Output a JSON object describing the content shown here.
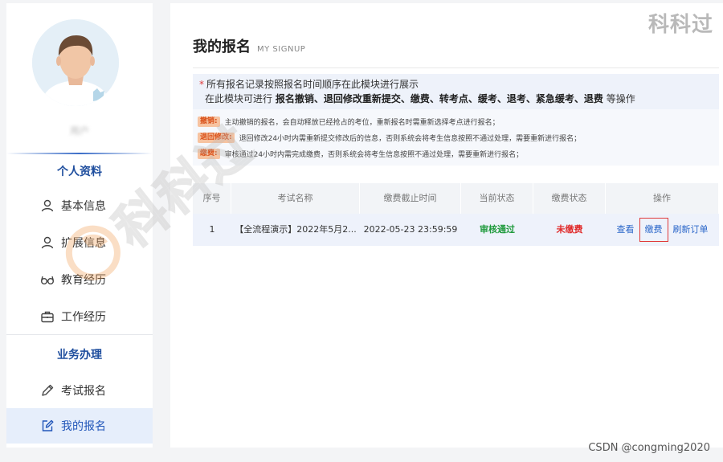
{
  "brand": "科科过",
  "credit": "CSDN @congming2020",
  "user": {
    "name": "用户"
  },
  "sidebar": {
    "personal_title": "个人资料",
    "business_title": "业务办理",
    "items": [
      {
        "label": "基本信息",
        "icon": "user-icon"
      },
      {
        "label": "扩展信息",
        "icon": "user-icon"
      },
      {
        "label": "教育经历",
        "icon": "glasses-icon"
      },
      {
        "label": "工作经历",
        "icon": "briefcase-icon"
      },
      {
        "label": "考试报名",
        "icon": "pencil-icon"
      },
      {
        "label": "我的报名",
        "icon": "edit-icon",
        "active": true
      }
    ]
  },
  "page": {
    "title": "我的报名",
    "subtitle": "MY SIGNUP"
  },
  "notice": {
    "star": "*",
    "line1": "所有报名记录按照报名时间顺序在此模块进行展示",
    "line2_prefix": "在此模块可进行",
    "line2_bold": "报名撤销、退回修改重新提交、缴费、转考点、缓考、退考、紧急缓考、退费",
    "line2_suffix": "等操作",
    "rules": [
      {
        "tag": "撤销:",
        "text": "主动撤销的报名，会自动释放已经抢占的考位，重新报名时需重新选择考点进行报名；"
      },
      {
        "tag": "退回修改:",
        "text": "退回修改24小时内需重新提交修改后的信息，否则系统会将考生信息按照不通过处理，需要重新进行报名；"
      },
      {
        "tag": "缴费:",
        "text": "审核通过24小时内需完成缴费，否则系统会将考生信息按照不通过处理，需要重新进行报名；"
      }
    ]
  },
  "table": {
    "headers": [
      "序号",
      "考试名称",
      "缴费截止时间",
      "当前状态",
      "缴费状态",
      "操作"
    ],
    "rows": [
      {
        "index": "1",
        "name": "【全流程演示】2022年5月2...",
        "deadline": "2022-05-23 23:59:59",
        "status": "审核通过",
        "pay_status": "未缴费",
        "actions": [
          "查看",
          "缴费",
          "刷新订单"
        ]
      }
    ]
  },
  "colors": {
    "accent": "#2a66c9",
    "success": "#1f9a3c",
    "danger": "#e02a2a"
  }
}
